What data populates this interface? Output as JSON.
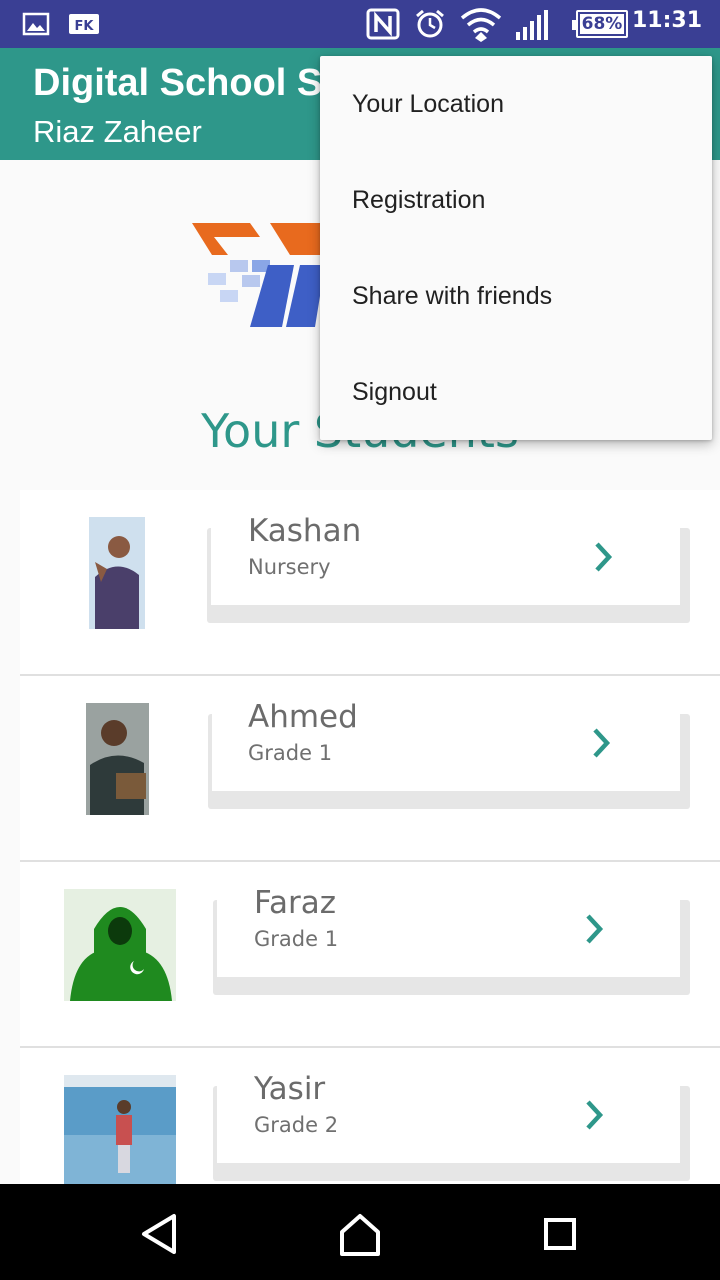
{
  "status_bar": {
    "time": "11:31",
    "battery": "68%",
    "icons": [
      "image-icon",
      "fk-app-icon",
      "nfc-icon",
      "alarm-icon",
      "wifi-icon",
      "signal-icon",
      "battery-icon"
    ]
  },
  "app_bar": {
    "title": "Digital School Su",
    "subtitle": "Riaz Zaheer"
  },
  "section_title": "Your Students",
  "students": [
    {
      "name": "Kashan",
      "grade": "Nursery"
    },
    {
      "name": "Ahmed",
      "grade": "Grade 1"
    },
    {
      "name": "Faraz",
      "grade": "Grade 1"
    },
    {
      "name": "Yasir",
      "grade": "Grade 2"
    }
  ],
  "menu": {
    "items": [
      "Your Location",
      "Registration",
      "Share with friends",
      "Signout"
    ]
  },
  "nav": {
    "icons": [
      "back-icon",
      "home-icon",
      "recents-icon"
    ]
  },
  "colors": {
    "status_bar": "#3a3f94",
    "app_bar": "#2e978a",
    "accent": "#2e978a"
  }
}
